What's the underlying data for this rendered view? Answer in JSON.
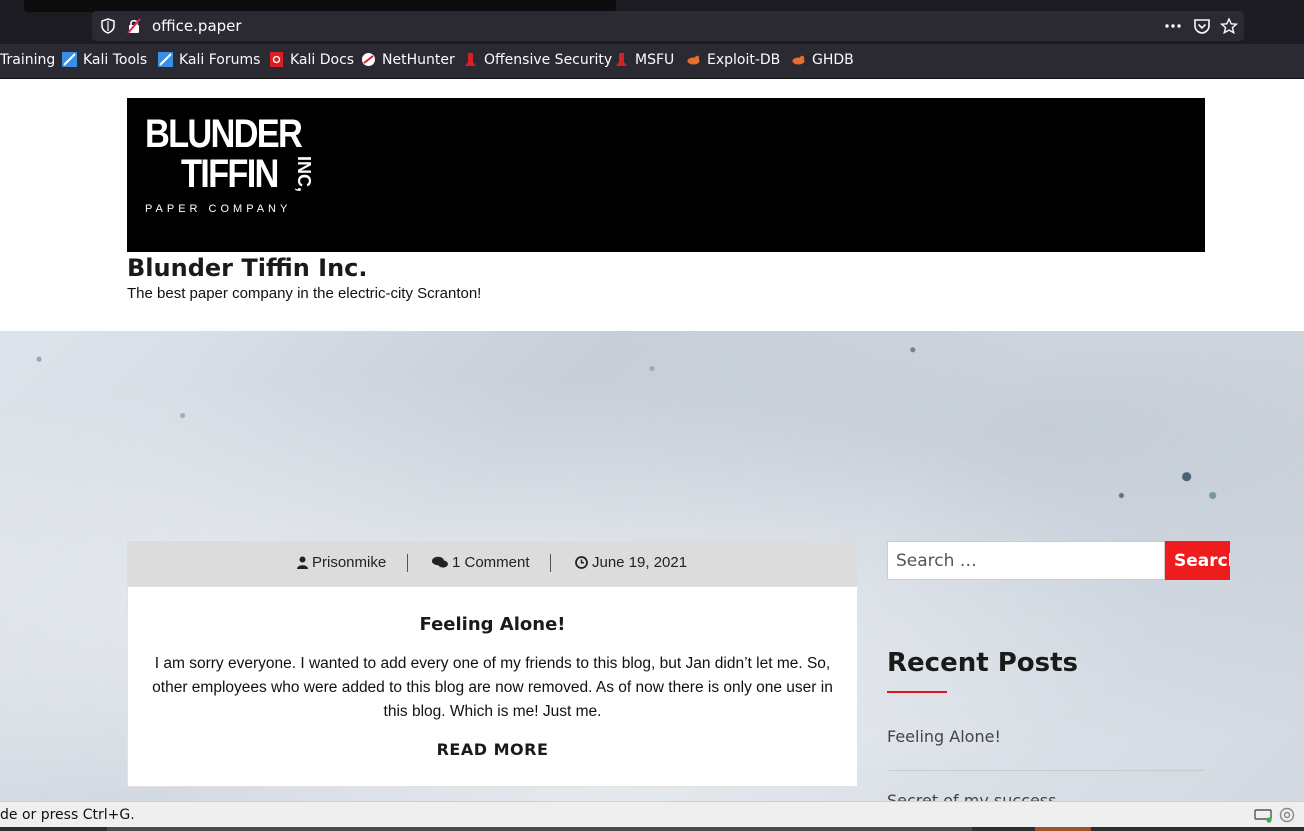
{
  "browser": {
    "url": "office.paper",
    "bookmarks": [
      {
        "label": "Training",
        "icon": "kali-icon"
      },
      {
        "label": "Kali Tools",
        "icon": "kali-tools-icon"
      },
      {
        "label": "Kali Forums",
        "icon": "kali-forums-icon"
      },
      {
        "label": "Kali Docs",
        "icon": "kali-docs-icon"
      },
      {
        "label": "NetHunter",
        "icon": "nethunter-icon"
      },
      {
        "label": "Offensive Security",
        "icon": "offsec-icon"
      },
      {
        "label": "MSFU",
        "icon": "msfu-icon"
      },
      {
        "label": "Exploit-DB",
        "icon": "exploitdb-icon"
      },
      {
        "label": "GHDB",
        "icon": "ghdb-icon"
      }
    ]
  },
  "header": {
    "logo": {
      "line1": "BLUNDER",
      "line2": "TIFFIN",
      "inc": "INC,",
      "tagline": "PAPER COMPANY"
    },
    "site_title": "Blunder Tiffin Inc.",
    "site_description": "The best paper company in the electric-city Scranton!"
  },
  "post": {
    "author": "Prisonmike",
    "comments": "1 Comment",
    "date": "June 19, 2021",
    "title": "Feeling Alone!",
    "excerpt": "I am sorry everyone. I wanted to add every one of my friends to this blog, but Jan didn’t let me. So, other employees who were added to this blog are now removed. As of now there is only one user in this blog. Which is me! Just me.",
    "read_more": "READ MORE"
  },
  "sidebar": {
    "search_placeholder": "Search …",
    "search_button": "Search",
    "recent_posts_title": "Recent Posts",
    "recent_posts": [
      "Feeling Alone!",
      "Secret of my success"
    ]
  },
  "statusbar": {
    "text": "de or press Ctrl+G."
  },
  "colors": {
    "accent": "#ee1c1c",
    "chrome": "#2b2a33",
    "banner": "#000000"
  }
}
